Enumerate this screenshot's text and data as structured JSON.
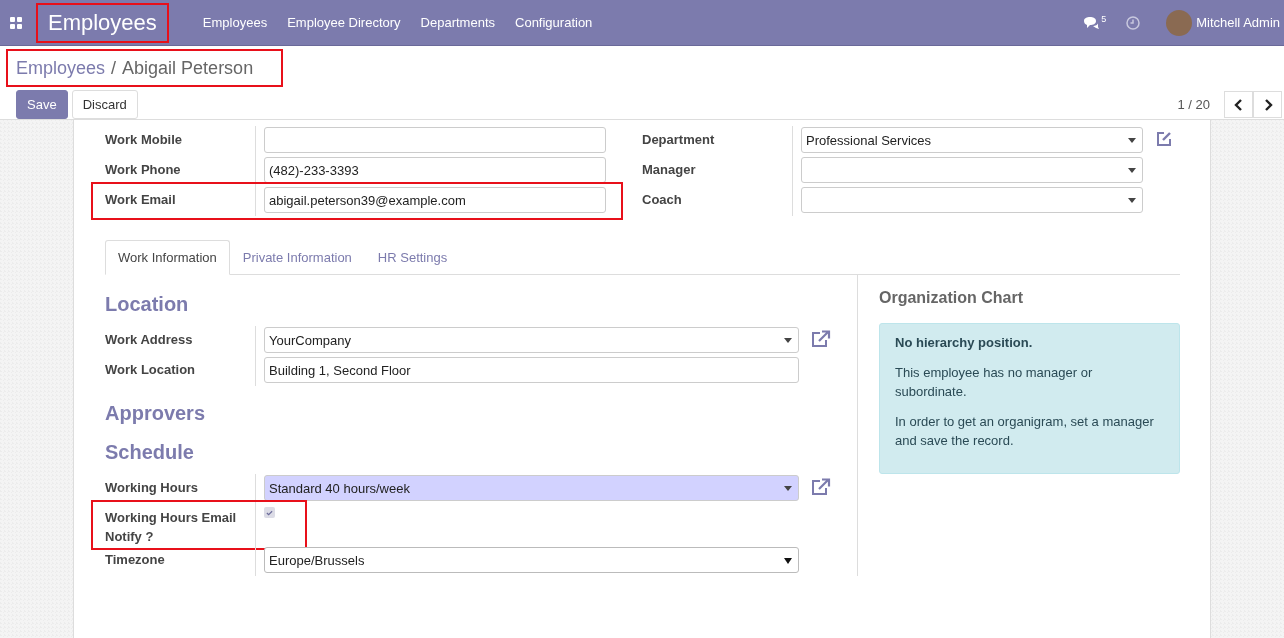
{
  "navbar": {
    "app_name": {
      "text": "Employees",
      "highlighted": true
    },
    "menu": [
      "Employees",
      "Employee Directory",
      "Departments",
      "Configuration"
    ],
    "messages_count": "5",
    "user": "Mitchell Admin"
  },
  "breadcrumb": {
    "items": [
      "Employees",
      "Abigail Peterson"
    ],
    "separator": "/",
    "highlighted": true
  },
  "buttons": [
    {
      "label": "Save",
      "kind": "primary"
    },
    {
      "label": "Discard",
      "kind": "secondary"
    }
  ],
  "pager": "1 / 20",
  "form_left": [
    {
      "label": "Work Mobile",
      "highlighted": false
    },
    {
      "label": "Work Phone",
      "value": "(482)-233-3393",
      "highlighted": false
    },
    {
      "label": "Work Email",
      "value": "abigail.peterson39@example.com",
      "highlighted": true
    }
  ],
  "form_right": [
    {
      "label": "Department",
      "value": "Professional Services",
      "link": true
    },
    {
      "label": "Manager",
      "link": false
    },
    {
      "label": "Coach",
      "link": false
    }
  ],
  "tabs": [
    {
      "label": "Work Information",
      "selected": true
    },
    {
      "label": "Private Information",
      "selected": false
    },
    {
      "label": "HR Settings",
      "selected": false
    }
  ],
  "sections": [
    {
      "title": "Location",
      "fields": [
        {
          "kind": "select",
          "label": "Work Address",
          "value": "YourCompany",
          "link": true,
          "required": false,
          "highlighted": false
        },
        {
          "kind": "text",
          "label": "Work Location",
          "value": "Building 1, Second Floor",
          "link": false,
          "required": false,
          "highlighted": false
        }
      ]
    },
    {
      "title": "Approvers"
    },
    {
      "title": "Schedule",
      "fields": [
        {
          "kind": "select",
          "label": "Working Hours",
          "value": "Standard 40 hours/week",
          "link": true,
          "required": true,
          "highlighted": false
        },
        {
          "kind": "checkbox",
          "label": "Working Hours Email Notify ?",
          "checked": true,
          "highlighted": true
        },
        {
          "kind": "native-select",
          "label": "Timezone",
          "value": "Europe/Brussels",
          "link": false,
          "required": false,
          "highlighted": false
        }
      ]
    }
  ],
  "org_chart": {
    "title": "Organization Chart",
    "heading": "No hierarchy position.",
    "paragraphs": [
      "This employee has no manager or subordinate.",
      "In order to get an organigram, set a manager and save the record."
    ]
  }
}
